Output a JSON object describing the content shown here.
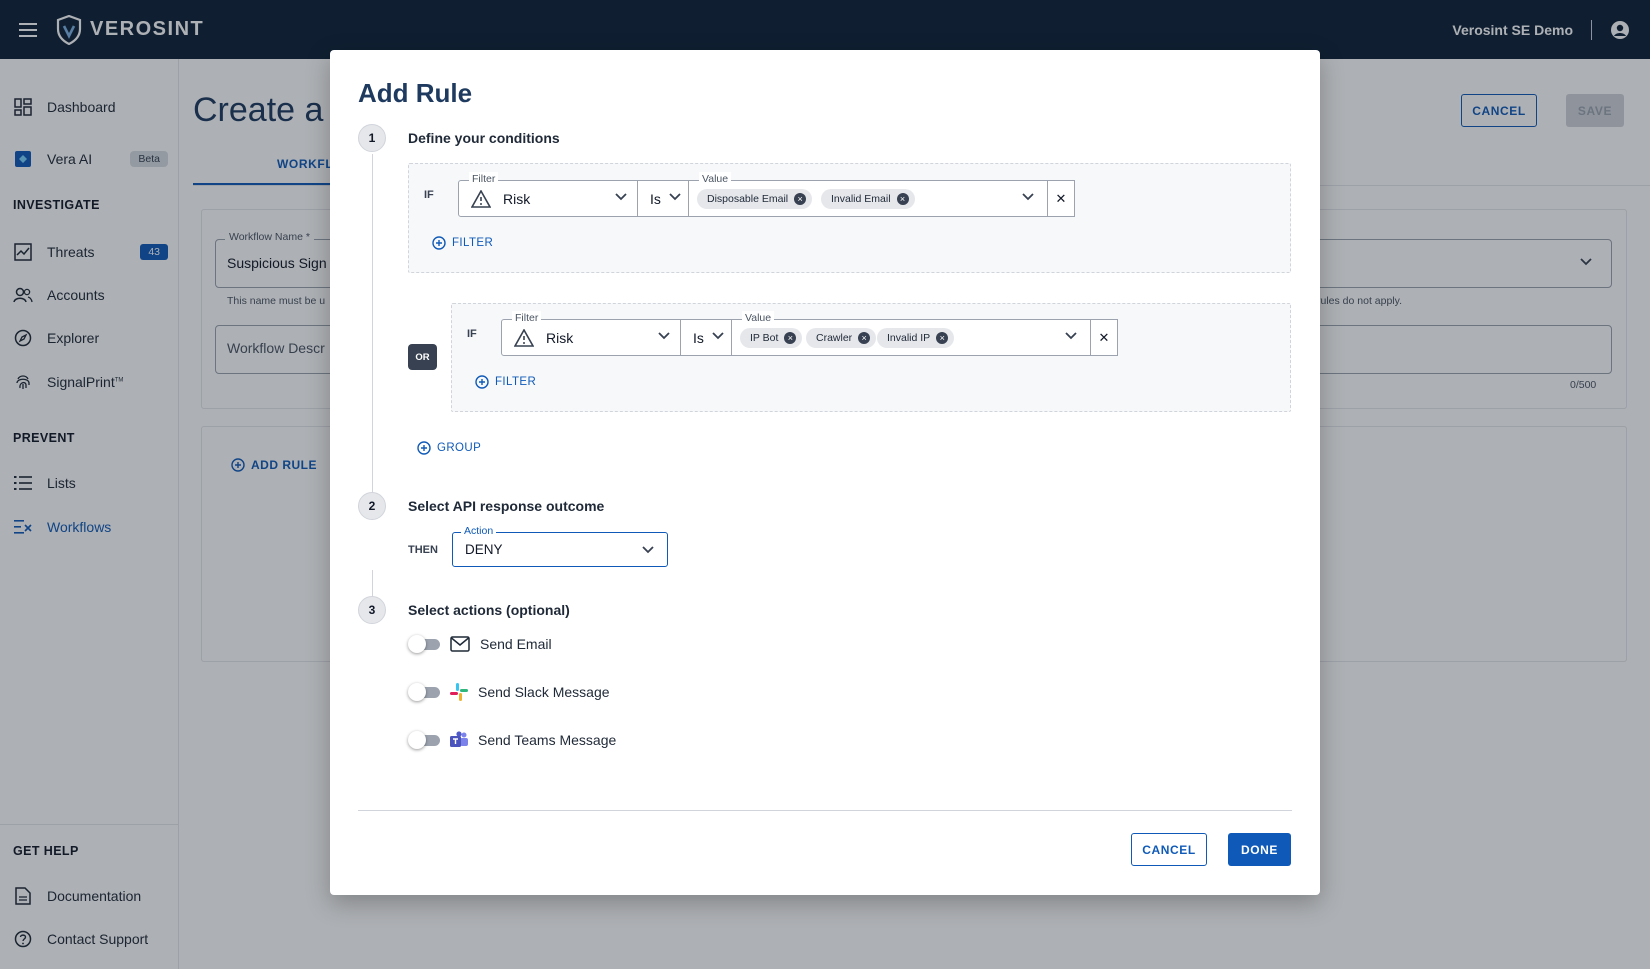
{
  "topbar": {
    "brand": "VEROSINT",
    "account": "Verosint SE Demo"
  },
  "sidebar": {
    "dashboard": "Dashboard",
    "vera_ai": "Vera AI",
    "vera_badge": "Beta",
    "investigate": "INVESTIGATE",
    "threats": "Threats",
    "threats_count": "43",
    "accounts": "Accounts",
    "explorer": "Explorer",
    "signalprint": "SignalPrint",
    "signalprint_tm": "TM",
    "prevent": "PREVENT",
    "lists": "Lists",
    "workflows": "Workflows",
    "get_help": "GET HELP",
    "documentation": "Documentation",
    "contact_support": "Contact Support"
  },
  "page": {
    "title": "Create a W",
    "tab": "WORKFLO",
    "cancel": "CANCEL",
    "save": "SAVE",
    "workflow_name_label": "Workflow Name *",
    "workflow_name_value": "Suspicious Sign",
    "name_help": "This name must be u",
    "right_help": "rules do not apply.",
    "description_placeholder": "Workflow Descr",
    "description_count": "0/500",
    "add_rule": "ADD RULE"
  },
  "modal": {
    "title": "Add Rule",
    "step1": {
      "number": "1",
      "title": "Define your conditions"
    },
    "step2": {
      "number": "2",
      "title": "Select API response outcome"
    },
    "step3": {
      "number": "3",
      "title": "Select actions (optional)"
    },
    "groups": [
      {
        "if": "IF",
        "filter_label": "Filter",
        "filter_value": "Risk",
        "operator": "Is",
        "value_label": "Value",
        "chips": [
          "Disposable Email",
          "Invalid Email"
        ],
        "add_filter": "FILTER"
      },
      {
        "if": "IF",
        "filter_label": "Filter",
        "filter_value": "Risk",
        "operator": "Is",
        "value_label": "Value",
        "chips": [
          "IP Bot",
          "Crawler",
          "Invalid IP"
        ],
        "add_filter": "FILTER"
      }
    ],
    "or_label": "OR",
    "add_group": "GROUP",
    "then_label": "THEN",
    "action_label": "Action",
    "action_value": "DENY",
    "toggles": [
      {
        "label": "Send Email",
        "enabled": false
      },
      {
        "label": "Send Slack Message",
        "enabled": false
      },
      {
        "label": "Send Teams Message",
        "enabled": false
      }
    ],
    "cancel": "CANCEL",
    "done": "DONE"
  },
  "colors": {
    "topbar": "#0d2136",
    "accent": "#0f5ab8",
    "heading": "#1e3a5f"
  }
}
